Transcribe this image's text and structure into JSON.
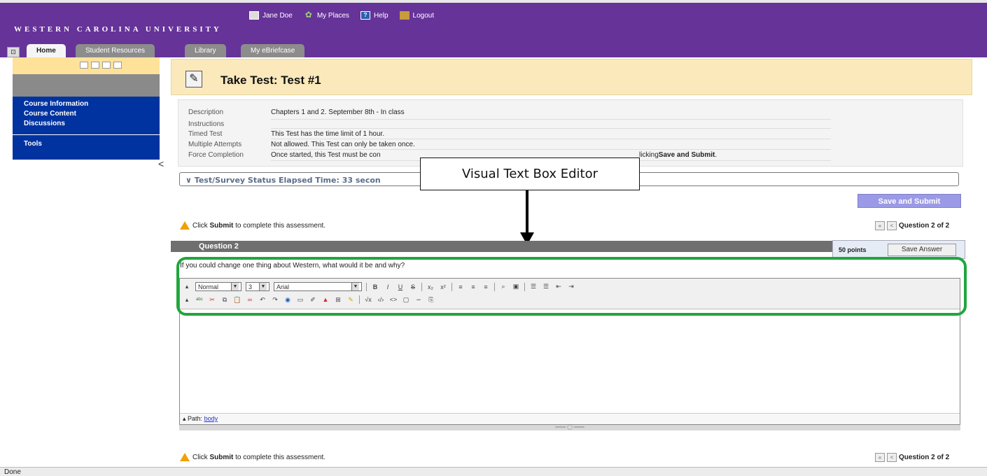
{
  "header": {
    "university": "WESTERN CAROLINA UNIVERSITY",
    "global_nav": [
      {
        "label": "Jane Doe",
        "icon": "user-icon"
      },
      {
        "label": "My Places",
        "icon": "places-icon"
      },
      {
        "label": "Help",
        "icon": "help-icon"
      },
      {
        "label": "Logout",
        "icon": "logout-icon"
      }
    ]
  },
  "tabs": [
    {
      "label": "Home"
    },
    {
      "label": "Student Resources"
    },
    {
      "label": "Library"
    },
    {
      "label": "My eBriefcase"
    }
  ],
  "leftnav": {
    "items": [
      "Course Information",
      "Course Content",
      "Discussions"
    ],
    "tools": "Tools"
  },
  "page": {
    "title": "Take Test: Test #1"
  },
  "info": {
    "rows": [
      {
        "label": "Description",
        "value": "Chapters 1 and 2.  September 8th - In class"
      },
      {
        "label": "Instructions",
        "value": ""
      },
      {
        "label": "Timed Test",
        "value": "This Test has the time limit of 1 hour."
      },
      {
        "label": "Multiple Attempts",
        "value": "Not allowed. This Test can only be taken once."
      },
      {
        "label": "Force Completion",
        "value": "Once started, this Test must be con"
      }
    ],
    "force_tail_pre": "licking ",
    "force_tail_bold": "Save and Submit",
    "force_tail_post": "."
  },
  "status": {
    "text": "Test/Survey Status Elapsed Time: 33 secon"
  },
  "annotation": {
    "label": "Visual Text Box Editor"
  },
  "actions": {
    "save_submit": "Save and Submit",
    "save_answer": "Save Answer"
  },
  "assessment": {
    "warn_pre": "Click ",
    "warn_bold": "Submit",
    "warn_post": " to complete this assessment.",
    "pager": "Question 2 of 2"
  },
  "question": {
    "header": "Question 2",
    "points": "50 points",
    "text": "If you could change one thing about Western, what would it be and why?"
  },
  "editor": {
    "format": "Normal",
    "size": "3",
    "font": "Arial",
    "path_label": "Path:",
    "path_value": "body"
  },
  "footer": {
    "status": "Done"
  }
}
